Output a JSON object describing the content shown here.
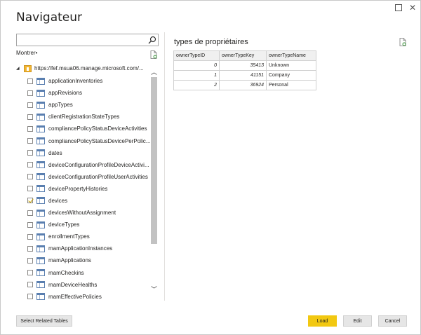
{
  "window": {
    "title": "Navigateur",
    "maximize_icon": "maximize-icon",
    "close_symbol": "✕"
  },
  "left_pane": {
    "search_value": "",
    "show_label": "Montrer•",
    "root_label": "https://fef.msua06.manage.microsoft.com/...",
    "items": [
      {
        "label": "applicationInventories",
        "checked": false
      },
      {
        "label": "appRevisions",
        "checked": false
      },
      {
        "label": "appTypes",
        "checked": false
      },
      {
        "label": "clientRegistrationStateTypes",
        "checked": false
      },
      {
        "label": "compliancePolicyStatusDeviceActivities",
        "checked": false
      },
      {
        "label": "compliancePolicyStatusDevicePerPolic...",
        "checked": false
      },
      {
        "label": "dates",
        "checked": false
      },
      {
        "label": "deviceConfigurationProfileDeviceActivi...",
        "checked": false
      },
      {
        "label": "deviceConfigurationProfileUserActivities",
        "checked": false
      },
      {
        "label": "devicePropertyHistories",
        "checked": false
      },
      {
        "label": "devices",
        "checked": true
      },
      {
        "label": "devicesWithoutAssignment",
        "checked": false
      },
      {
        "label": "deviceTypes",
        "checked": false
      },
      {
        "label": "enrollmentTypes",
        "checked": false
      },
      {
        "label": "mamApplicationInstances",
        "checked": false
      },
      {
        "label": "mamApplications",
        "checked": false
      },
      {
        "label": "mamCheckins",
        "checked": false
      },
      {
        "label": "mamDeviceHealths",
        "checked": false
      },
      {
        "label": "mamEffectivePolicies",
        "checked": false
      }
    ]
  },
  "preview": {
    "title": "types de propriétaires",
    "columns": [
      "ownerTypeID",
      "ownerTypeKey",
      "ownerTypeName"
    ],
    "rows": [
      [
        "0",
        "35413",
        "Unknown"
      ],
      [
        "1",
        "41151",
        "Company"
      ],
      [
        "2",
        "36924",
        "Personal"
      ]
    ]
  },
  "footer": {
    "select_related": "Select Related Tables",
    "load": "Load",
    "edit": "Edit",
    "cancel": "Cancel"
  },
  "colors": {
    "load_button": "#f2c811",
    "checkmark": "#c7a100",
    "table_icon": "#5a7fb0"
  }
}
